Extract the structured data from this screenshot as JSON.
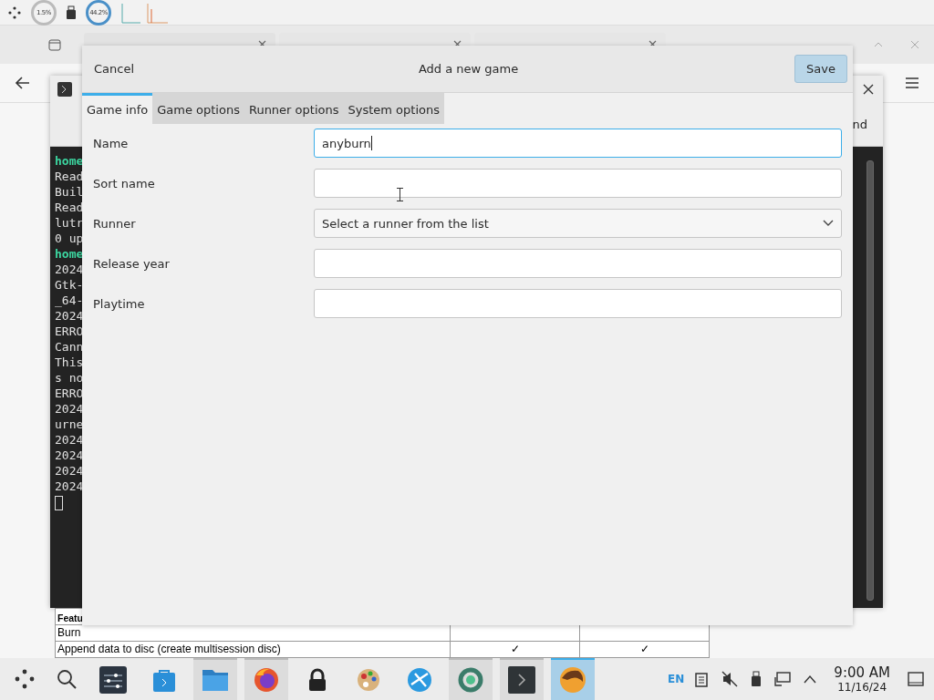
{
  "top_panel": {
    "cpu": "1.5%",
    "memory": "44.2%"
  },
  "terminal": {
    "toolbar_fragment": "nd",
    "lines": [
      {
        "text": "home",
        "kind": "prompt"
      },
      {
        "text": "Read",
        "kind": "out"
      },
      {
        "text": "Buil",
        "kind": "out"
      },
      {
        "text": "Read",
        "kind": "out"
      },
      {
        "text": "lutr",
        "kind": "out"
      },
      {
        "text": "0 up",
        "kind": "out"
      },
      {
        "text": "home",
        "kind": "prompt"
      },
      {
        "text": "2024",
        "kind": "out"
      },
      {
        "text": "Gtk-",
        "kind": "out"
      },
      {
        "text": "_64-",
        "kind": "out"
      },
      {
        "text": "2024",
        "kind": "out"
      },
      {
        "text": "ERRO",
        "kind": "out"
      },
      {
        "text": "Cann",
        "kind": "out"
      },
      {
        "text": "This",
        "kind": "out"
      },
      {
        "text": "s no",
        "kind": "out"
      },
      {
        "text": "ERRO",
        "kind": "out"
      },
      {
        "text": "2024",
        "kind": "out"
      },
      {
        "text": "urne",
        "kind": "out"
      },
      {
        "text": "2024",
        "kind": "out"
      },
      {
        "text": "2024",
        "kind": "out"
      },
      {
        "text": "2024",
        "kind": "out"
      },
      {
        "text": "2024",
        "kind": "out"
      }
    ]
  },
  "web_table": {
    "header": "Featu",
    "rows": [
      {
        "feature": "Burn",
        "checks": []
      },
      {
        "feature": "Append data to disc (create multisession disc)",
        "checks": [
          "✓",
          "✓"
        ]
      }
    ]
  },
  "dialog": {
    "cancel": "Cancel",
    "title": "Add a new game",
    "save": "Save",
    "tabs": [
      {
        "label": "Game info",
        "selected": true
      },
      {
        "label": "Game options",
        "selected": false
      },
      {
        "label": "Runner options",
        "selected": false
      },
      {
        "label": "System options",
        "selected": false
      }
    ],
    "fields": [
      {
        "label": "Name",
        "kind": "text",
        "value": "anyburn",
        "focused": true
      },
      {
        "label": "Sort name",
        "kind": "text",
        "focused": false
      },
      {
        "label": "Runner",
        "kind": "dropdown",
        "value": "Select a runner from the list",
        "focused": false
      },
      {
        "label": "Release year",
        "kind": "text",
        "focused": false
      },
      {
        "label": "Playtime",
        "kind": "text",
        "focused": false
      }
    ]
  },
  "taskbar": {
    "apps": [
      {
        "kind": "mixer",
        "running": false,
        "selected": false
      },
      {
        "kind": "store",
        "running": false,
        "selected": false
      },
      {
        "kind": "folder",
        "running": true,
        "selected": false
      },
      {
        "kind": "browser",
        "running": true,
        "selected": false
      },
      {
        "kind": "lock",
        "running": false,
        "selected": false
      },
      {
        "kind": "palette",
        "running": false,
        "selected": false
      },
      {
        "kind": "globe",
        "running": false,
        "selected": false
      },
      {
        "kind": "ring",
        "running": true,
        "selected": false
      },
      {
        "kind": "terminal",
        "running": true,
        "selected": false
      },
      {
        "kind": "game",
        "running": true,
        "selected": true
      }
    ],
    "language": "EN",
    "time": "9:00 AM",
    "date": "11/16/24"
  }
}
